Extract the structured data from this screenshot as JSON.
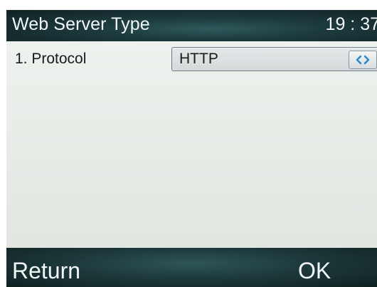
{
  "header": {
    "title": "Web Server Type",
    "clock": "19 : 37"
  },
  "rows": [
    {
      "label": "1. Protocol",
      "value": "HTTP",
      "control_icon": "left-right-arrows-icon"
    }
  ],
  "softkeys": {
    "left": "Return",
    "right": "OK"
  }
}
